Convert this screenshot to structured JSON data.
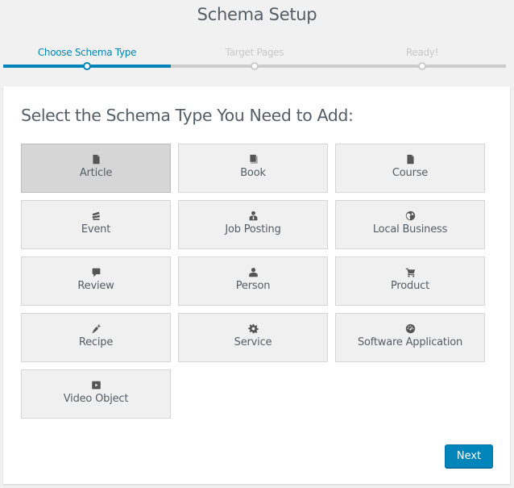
{
  "header": {
    "title": "Schema Setup"
  },
  "steps": [
    {
      "label": "Choose Schema Type",
      "state": "active"
    },
    {
      "label": "Target Pages",
      "state": "pending"
    },
    {
      "label": "Ready!",
      "state": "pending"
    }
  ],
  "main": {
    "heading": "Select the Schema Type You Need to Add:",
    "schema_types": [
      {
        "label": "Article",
        "icon": "document-icon",
        "selected": true
      },
      {
        "label": "Book",
        "icon": "book-icon",
        "selected": false
      },
      {
        "label": "Course",
        "icon": "document-icon",
        "selected": false
      },
      {
        "label": "Event",
        "icon": "tickets-icon",
        "selected": false
      },
      {
        "label": "Job Posting",
        "icon": "businessman-icon",
        "selected": false
      },
      {
        "label": "Local Business",
        "icon": "globe-icon",
        "selected": false
      },
      {
        "label": "Review",
        "icon": "comment-icon",
        "selected": false
      },
      {
        "label": "Person",
        "icon": "person-icon",
        "selected": false
      },
      {
        "label": "Product",
        "icon": "cart-icon",
        "selected": false
      },
      {
        "label": "Recipe",
        "icon": "carrot-icon",
        "selected": false
      },
      {
        "label": "Service",
        "icon": "gear-icon",
        "selected": false
      },
      {
        "label": "Software Application",
        "icon": "dashboard-icon",
        "selected": false
      },
      {
        "label": "Video Object",
        "icon": "video-icon",
        "selected": false
      }
    ]
  },
  "footer": {
    "next_label": "Next"
  },
  "colors": {
    "accent": "#0085ba",
    "inactive_step": "#cccccc",
    "text": "#555d66",
    "tile_bg": "#f0f0f0",
    "tile_selected_bg": "#d6d6d6"
  }
}
